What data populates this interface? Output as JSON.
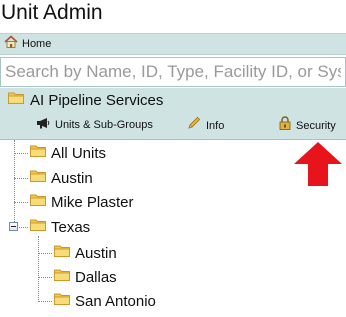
{
  "page": {
    "title": "Unit Admin"
  },
  "nav": {
    "home_label": "Home"
  },
  "search": {
    "placeholder": "Search by Name, ID, Type, Facility ID, or System"
  },
  "selected_group": {
    "name": "AI Pipeline Services",
    "actions": {
      "units_label": "Units & Sub-Groups",
      "info_label": "Info",
      "security_label": "Security"
    }
  },
  "tree": {
    "items": [
      {
        "label": "All Units"
      },
      {
        "label": "Austin"
      },
      {
        "label": "Mike Plaster"
      },
      {
        "label": "Texas",
        "expanded": true
      },
      {
        "label": "Austin"
      },
      {
        "label": "Dallas"
      },
      {
        "label": "San Antonio"
      }
    ]
  },
  "colors": {
    "accent_bar": "#cfe3e3",
    "folder": "#f2c94c",
    "arrow": "#e8141c"
  }
}
